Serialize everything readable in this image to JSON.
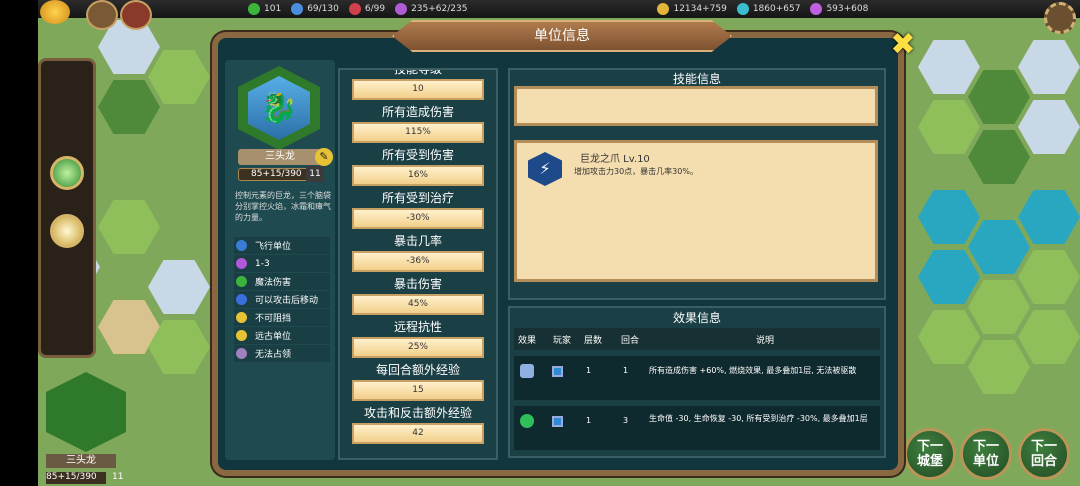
{
  "topbar": {
    "resources": [
      {
        "icon": "leaf-icon",
        "value": "101",
        "color": "#3cb43c"
      },
      {
        "icon": "population-icon",
        "value": "69/130",
        "color": "#4a8ee0"
      },
      {
        "icon": "army-icon",
        "value": "6/99",
        "color": "#d0404a"
      },
      {
        "icon": "magic-icon",
        "value": "235+62/235",
        "color": "#b05cd6"
      },
      {
        "icon": "gold-icon",
        "value": "12134+759",
        "color": "#e2b43a"
      },
      {
        "icon": "gem-icon",
        "value": "1860+657",
        "color": "#3cbcd0"
      },
      {
        "icon": "mana-icon",
        "value": "593+608",
        "color": "#c060e0"
      }
    ]
  },
  "dialog": {
    "title": "单位信息",
    "unit": {
      "name": "三头龙",
      "hp": "85+15/390",
      "level": "11",
      "description": "控制元素的巨龙，三个脑袋分别掌控火焰，冰霜和瘴气的力量。",
      "traits": [
        {
          "icon": "flying-icon",
          "label": "飞行单位",
          "color": "#3a7bd5"
        },
        {
          "icon": "range-icon",
          "label": "1-3",
          "color": "#b058d8"
        },
        {
          "icon": "magic-damage-icon",
          "label": "魔法伤害",
          "color": "#3cb43c"
        },
        {
          "icon": "move-after-attack-icon",
          "label": "可以攻击后移动",
          "color": "#3a6fe0"
        },
        {
          "icon": "unstoppable-icon",
          "label": "不可阻挡",
          "color": "#e8c235"
        },
        {
          "icon": "ranged-icon",
          "label": "远古单位",
          "color": "#e8c235"
        },
        {
          "icon": "no-capture-icon",
          "label": "无法占领",
          "color": "#9f7fc0"
        }
      ]
    },
    "stats": [
      {
        "label": "技能等级",
        "value": "10"
      },
      {
        "label": "所有造成伤害",
        "value": "115%"
      },
      {
        "label": "所有受到伤害",
        "value": "16%"
      },
      {
        "label": "所有受到治疗",
        "value": "-30%"
      },
      {
        "label": "暴击几率",
        "value": "-36%"
      },
      {
        "label": "暴击伤害",
        "value": "45%"
      },
      {
        "label": "远程抗性",
        "value": "25%"
      },
      {
        "label": "每回合额外经验",
        "value": "15"
      },
      {
        "label": "攻击和反击额外经验",
        "value": "42"
      }
    ],
    "skill_header": "技能信息",
    "skill": {
      "name": "巨龙之爪 Lv.10",
      "description": "增加攻击力30点，暴击几率30%。"
    },
    "effects_header": "效果信息",
    "effects_columns": {
      "effect": "效果",
      "player": "玩家",
      "stacks": "层数",
      "turns": "回合",
      "desc": "说明"
    },
    "effects": [
      {
        "icon": "burn-effect-icon",
        "stacks": "1",
        "turns": "1",
        "desc": "所有造成伤害 +60%, 燃烧效果, 最多叠加1层, 无法被驱散"
      },
      {
        "icon": "poison-effect-icon",
        "stacks": "1",
        "turns": "3",
        "desc": "生命值 -30, 生命恢复 -30, 所有受到治疗 -30%, 最多叠加1层"
      }
    ]
  },
  "bottom_left": {
    "name": "三头龙",
    "hp": "85+15/390",
    "level": "11"
  },
  "nav_buttons": [
    {
      "line1": "下一",
      "line2": "城堡"
    },
    {
      "line1": "下一",
      "line2": "单位"
    },
    {
      "line1": "下一",
      "line2": "回合"
    }
  ]
}
